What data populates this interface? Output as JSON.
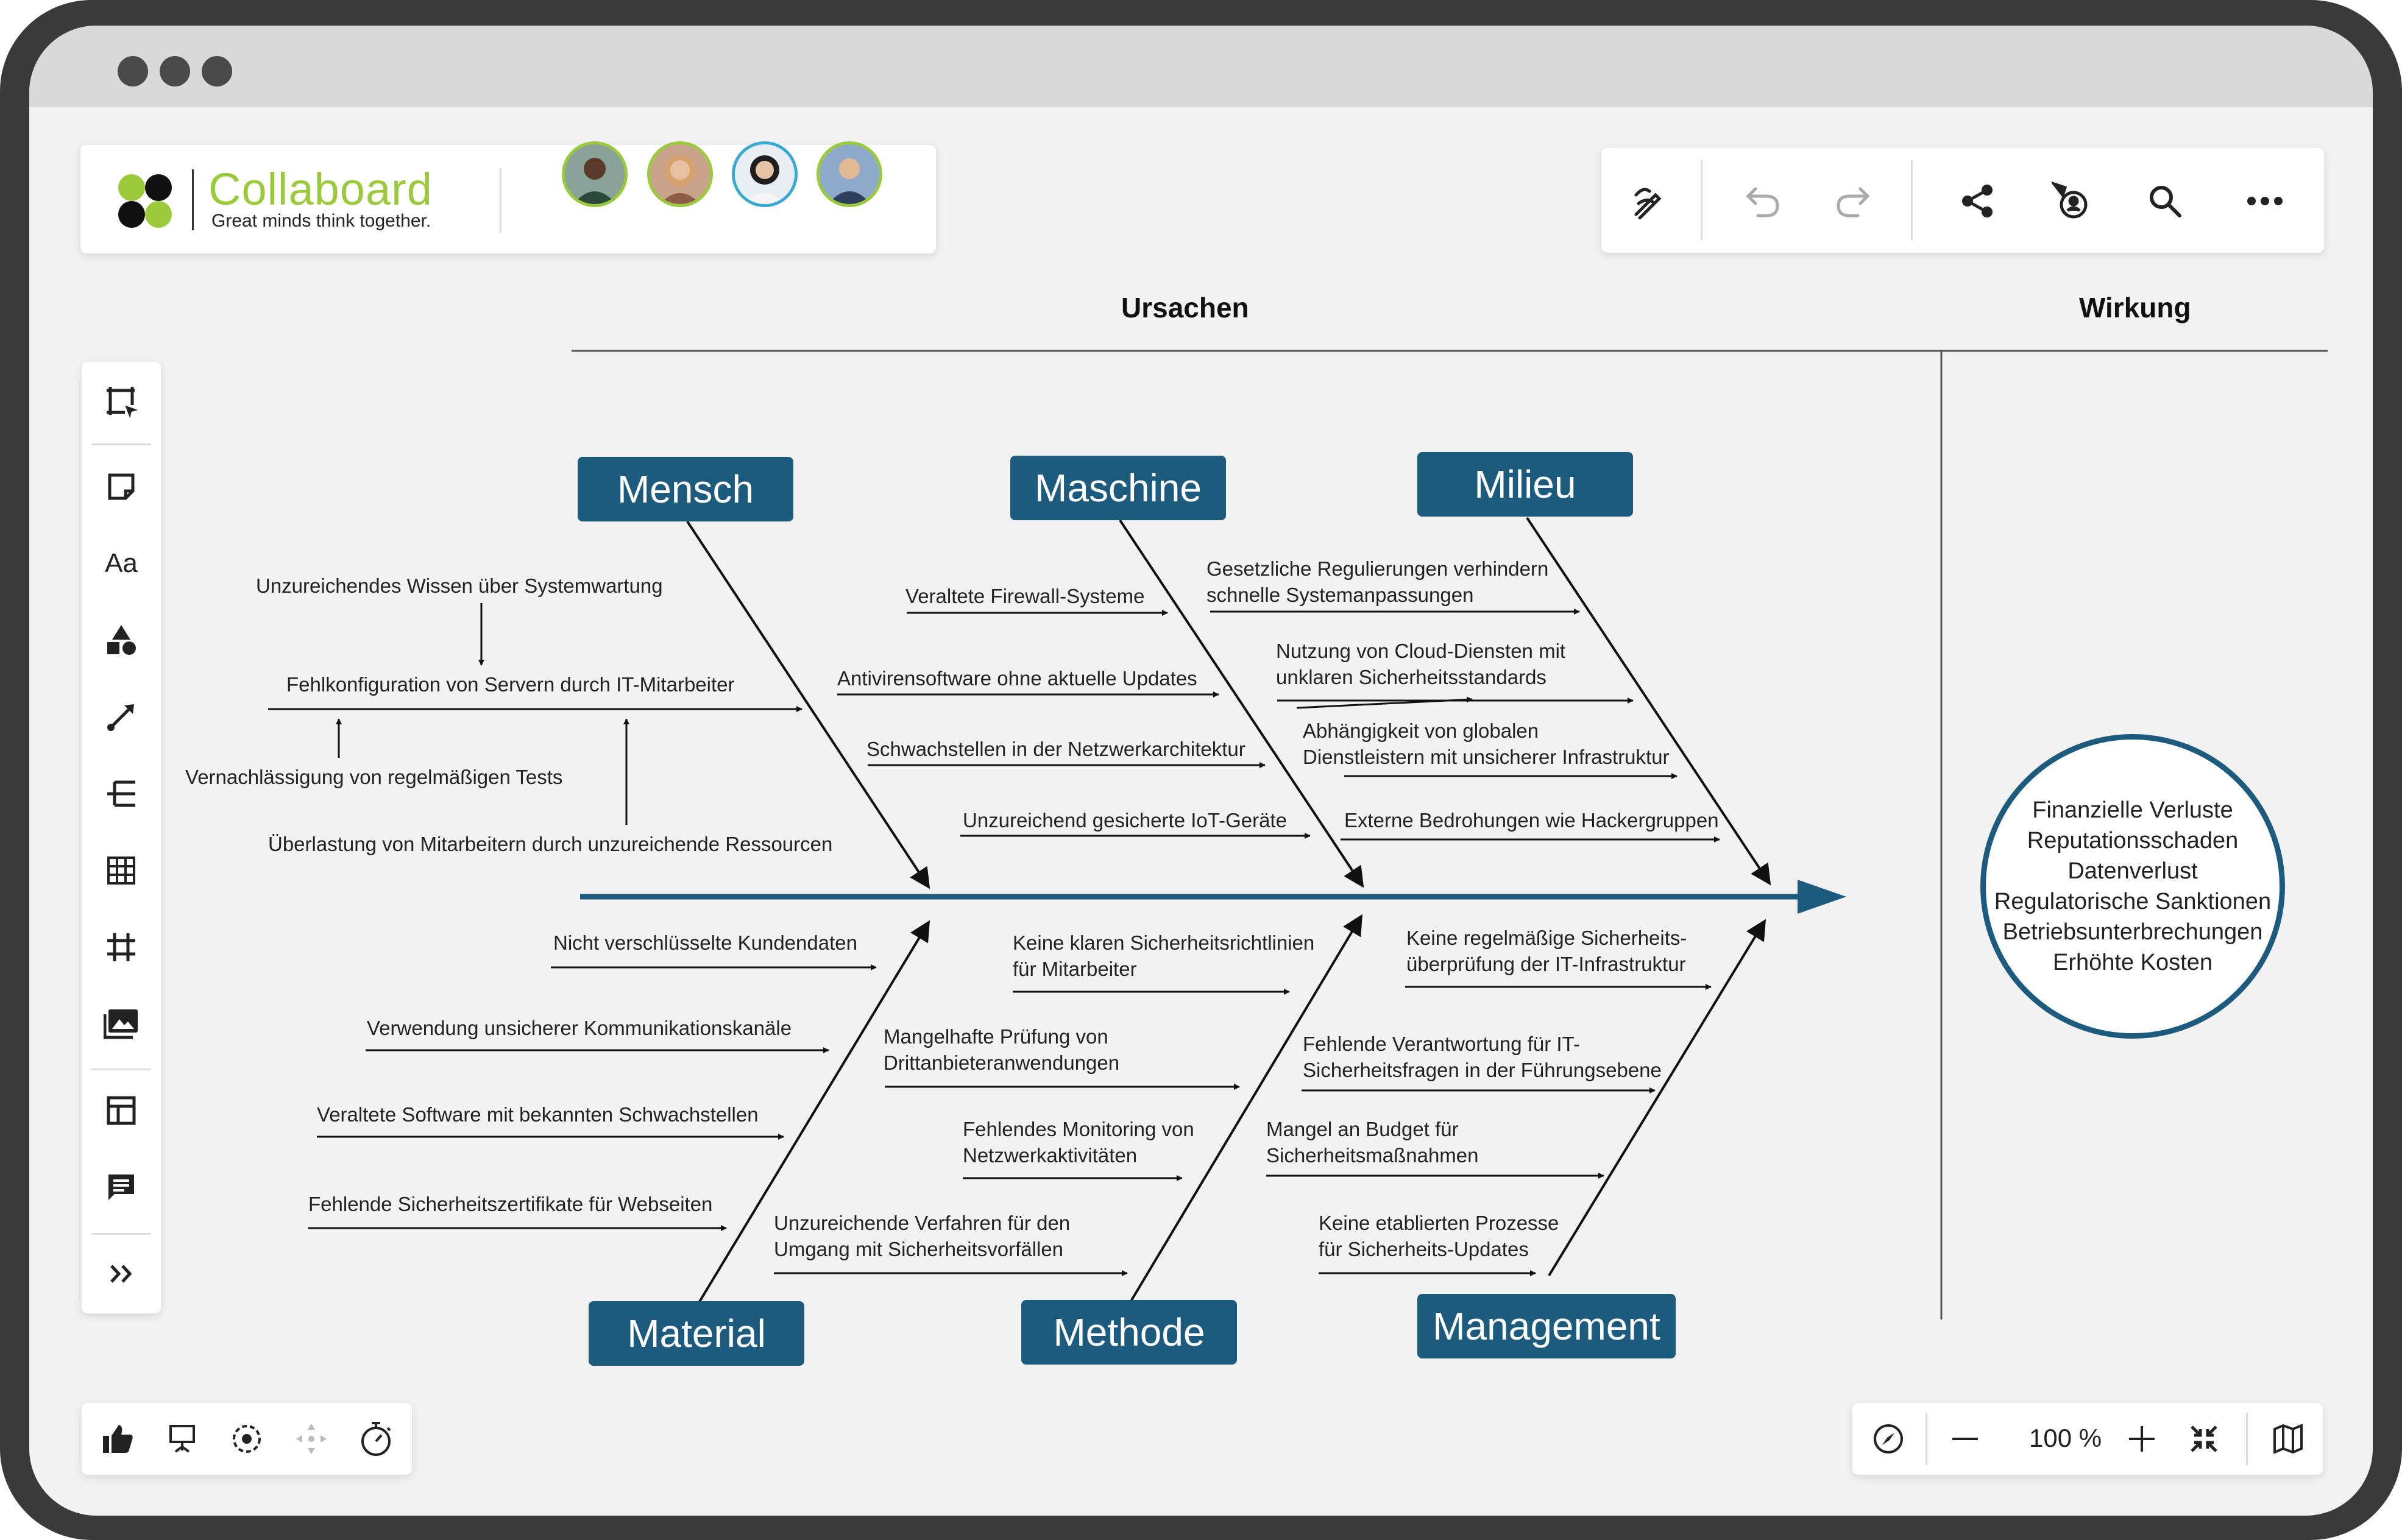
{
  "app": {
    "logo_name": "Collaboard",
    "tagline": "Great minds think together.",
    "zoom": "100 %"
  },
  "colors": {
    "brand_green": "#9aca3c",
    "brand_black": "#111111",
    "fishbone_blue": "#1d5b7e",
    "frame": "#3a3a3a"
  },
  "toolbar_top": {
    "icons": [
      "pen-icon",
      "undo-icon",
      "redo-icon",
      "share-icon",
      "follow-user-icon",
      "search-icon",
      "more-icon"
    ]
  },
  "toolbar_left": {
    "icons": [
      "select-icon",
      "sticky-note-icon",
      "text-icon",
      "shapes-icon",
      "connector-icon",
      "mindmap-icon",
      "table-icon",
      "frame-icon",
      "image-icon",
      "template-icon",
      "comment-icon",
      "expand-icon"
    ],
    "text_tool_label": "Aa"
  },
  "toolbar_bottom_left": {
    "icons": [
      "vote-icon",
      "presentation-icon",
      "focus-icon",
      "spread-icon",
      "timer-icon"
    ]
  },
  "toolbar_bottom_right": {
    "icons": [
      "compass-icon",
      "zoom-out-icon",
      "zoom-in-icon",
      "fit-icon",
      "map-icon"
    ]
  },
  "board": {
    "heading_causes": "Ursachen",
    "heading_effect": "Wirkung",
    "categories": {
      "mensch": "Mensch",
      "maschine": "Maschine",
      "milieu": "Milieu",
      "material": "Material",
      "methode": "Methode",
      "management": "Management"
    },
    "mensch_causes": {
      "c1": "Unzureichendes Wissen über Systemwartung",
      "c2": "Fehlkonfiguration von Servern durch IT-Mitarbeiter",
      "c3": "Vernachlässigung von regelmäßigen Tests",
      "c4": "Überlastung von Mitarbeitern durch unzureichende Ressourcen"
    },
    "maschine_causes": {
      "c1": "Veraltete Firewall-Systeme",
      "c2": "Antivirensoftware ohne aktuelle Updates",
      "c3": "Schwachstellen in der Netzwerkarchitektur",
      "c4": "Unzureichend gesicherte IoT-Geräte"
    },
    "milieu_causes": {
      "c1a": "Gesetzliche Regulierungen verhindern",
      "c1b": "schnelle Systemanpassungen",
      "c2a": "Nutzung von Cloud-Diensten mit",
      "c2b": "unklaren Sicherheitsstandards",
      "c3a": "Abhängigkeit von globalen",
      "c3b": "Dienstleistern mit unsicherer Infrastruktur",
      "c4": "Externe Bedrohungen wie Hackergruppen"
    },
    "material_causes": {
      "c1": "Nicht verschlüsselte Kundendaten",
      "c2": "Verwendung unsicherer Kommunikationskanäle",
      "c3": "Veraltete Software mit bekannten Schwachstellen",
      "c4": "Fehlende Sicherheitszertifikate für Webseiten"
    },
    "methode_causes": {
      "c1a": "Keine klaren Sicherheitsrichtlinien",
      "c1b": "für Mitarbeiter",
      "c2a": "Mangelhafte Prüfung von",
      "c2b": "Drittanbieteranwendungen",
      "c3a": "Fehlendes Monitoring von",
      "c3b": "Netzwerkaktivitäten",
      "c4a": "Unzureichende Verfahren für den",
      "c4b": "Umgang mit Sicherheitsvorfällen"
    },
    "management_causes": {
      "c1a": "Keine regelmäßige Sicherheits-",
      "c1b": "überprüfung der IT-Infrastruktur",
      "c2a": "Fehlende Verantwortung für IT-",
      "c2b": "Sicherheitsfragen in der Führungsebene",
      "c3a": "Mangel an Budget für",
      "c3b": "Sicherheitsmaßnahmen",
      "c4a": "Keine etablierten Prozesse",
      "c4b": "für Sicherheits-Updates"
    },
    "effects": [
      "Finanzielle Verluste",
      "Reputationsschaden",
      "Datenverlust",
      "Regulatorische Sanktionen",
      "Betriebsunterbrechungen",
      "Erhöhte Kosten"
    ]
  }
}
